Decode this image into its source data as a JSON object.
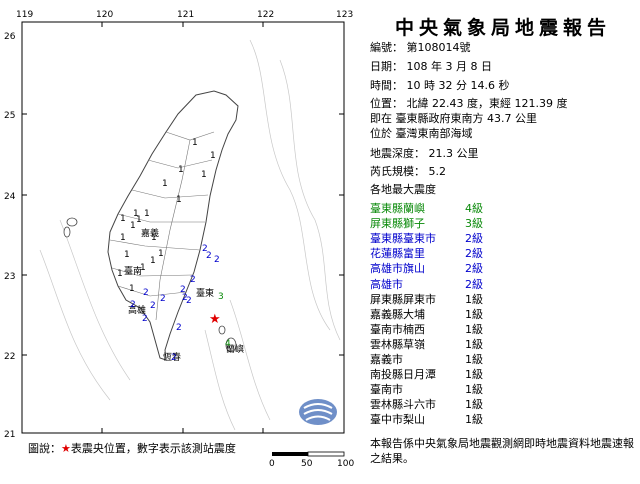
{
  "report": {
    "title": "中央氣象局地震報告",
    "number": "編號： 第108014號",
    "date": "日期： 108 年 3 月 8 日",
    "time": "時間： 10 時 32 分 14.6 秒",
    "position": "位置： 北緯 22.43 度，東經 121.39 度",
    "position_rel": "即在 臺東縣政府東南方 43.7 公里",
    "region": "位於 臺灣東南部海域",
    "depth": "地震深度： 21.3 公里",
    "magnitude": "芮氏規模： 5.2",
    "max_intensity_header": "各地最大震度",
    "stations": [
      {
        "loc": "臺東縣蘭嶼",
        "int": "4級",
        "color": "#0a8a0a"
      },
      {
        "loc": "屏東縣獅子",
        "int": "3級",
        "color": "#0a8a0a"
      },
      {
        "loc": "臺東縣臺東市",
        "int": "2級",
        "color": "#0000cc"
      },
      {
        "loc": "花蓮縣富里",
        "int": "2級",
        "color": "#0000cc"
      },
      {
        "loc": "高雄市旗山",
        "int": "2級",
        "color": "#0000cc"
      },
      {
        "loc": "高雄市",
        "int": "2級",
        "color": "#0000cc"
      },
      {
        "loc": "屏東縣屏東市",
        "int": "1級",
        "color": "#000000"
      },
      {
        "loc": "嘉義縣大埔",
        "int": "1級",
        "color": "#000000"
      },
      {
        "loc": "臺南市楠西",
        "int": "1級",
        "color": "#000000"
      },
      {
        "loc": "雲林縣草嶺",
        "int": "1級",
        "color": "#000000"
      },
      {
        "loc": "嘉義市",
        "int": "1級",
        "color": "#000000"
      },
      {
        "loc": "南投縣日月潭",
        "int": "1級",
        "color": "#000000"
      },
      {
        "loc": "臺南市",
        "int": "1級",
        "color": "#000000"
      },
      {
        "loc": "雲林縣斗六市",
        "int": "1級",
        "color": "#000000"
      },
      {
        "loc": "臺中市梨山",
        "int": "1級",
        "color": "#000000"
      }
    ],
    "footer": "本報告係中央氣象局地震觀測網即時地震資料地震速報之結果。"
  },
  "map": {
    "lon_ticks": [
      "119",
      "120",
      "121",
      "122",
      "123"
    ],
    "lat_ticks": [
      "26",
      "25",
      "24",
      "23",
      "22",
      "21"
    ],
    "scale_labels": [
      "0",
      "50",
      "100"
    ],
    "legend_prefix": "圖說：",
    "legend_star": "★",
    "legend_text": "表震央位置，數字表示該測站震度",
    "epicenter_color": "#e00000",
    "place_labels": [
      "嘉義",
      "臺南",
      "高雄",
      "臺東",
      "恆春",
      "蘭嶼"
    ],
    "intensity_marks": [
      "1",
      "1",
      "1",
      "1",
      "1",
      "1",
      "1",
      "1",
      "1",
      "1",
      "1",
      "1",
      "1",
      "1",
      "1",
      "1",
      "1",
      "1",
      "1",
      "2",
      "2",
      "2",
      "2",
      "2",
      "2",
      "2",
      "2",
      "2",
      "2",
      "2",
      "2",
      "2",
      "2",
      "3",
      "4"
    ]
  }
}
